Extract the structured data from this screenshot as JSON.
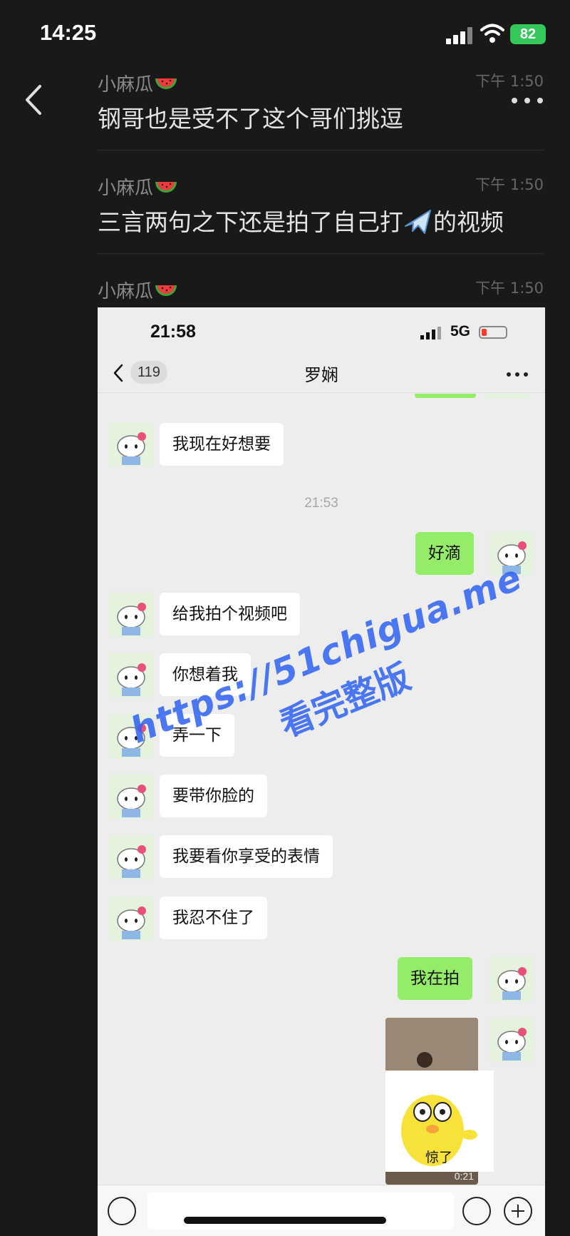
{
  "status_bar": {
    "time": "14:25",
    "battery": "82"
  },
  "header": {
    "back_icon": "chevron-left-icon",
    "more_icon": "more-dots-icon"
  },
  "forwarded": [
    {
      "sender": "小麻瓜",
      "sender_emoji": "watermelon-icon",
      "time": "下午 1:50",
      "text": "钢哥也是受不了这个哥们挑逗"
    },
    {
      "sender": "小麻瓜",
      "sender_emoji": "watermelon-icon",
      "time": "下午 1:50",
      "text_before": "三言两句之下还是拍了自己打",
      "text_icon": "airplane-icon",
      "text_after": "的视频"
    },
    {
      "sender": "小麻瓜",
      "sender_emoji": "watermelon-icon",
      "time": "下午 1:50"
    }
  ],
  "shot": {
    "status": {
      "time": "21:58",
      "network": "5G"
    },
    "header": {
      "unread": "119",
      "title": "罗娴"
    },
    "messages": [
      {
        "dir": "in",
        "text": "我现在好想要"
      },
      {
        "timestamp": "21:53"
      },
      {
        "dir": "out",
        "text": "好滴"
      },
      {
        "dir": "in",
        "text": "给我拍个视频吧"
      },
      {
        "dir": "in",
        "text": "你想着我"
      },
      {
        "dir": "in",
        "text": "弄一下"
      },
      {
        "dir": "in",
        "text": "要带你脸的"
      },
      {
        "dir": "in",
        "text": "我要看你享受的表情"
      },
      {
        "dir": "in",
        "text": "我忍不住了"
      },
      {
        "dir": "out",
        "text": "我在拍"
      }
    ],
    "video": {
      "duration": "0:21"
    },
    "sticker": {
      "caption": "惊了"
    }
  },
  "watermark": {
    "line1": "https://51chigua.me",
    "line2": "看完整版"
  },
  "colors": {
    "outgoing": "#95ec69",
    "incoming": "#ffffff",
    "watermark": "#2e60f2"
  }
}
